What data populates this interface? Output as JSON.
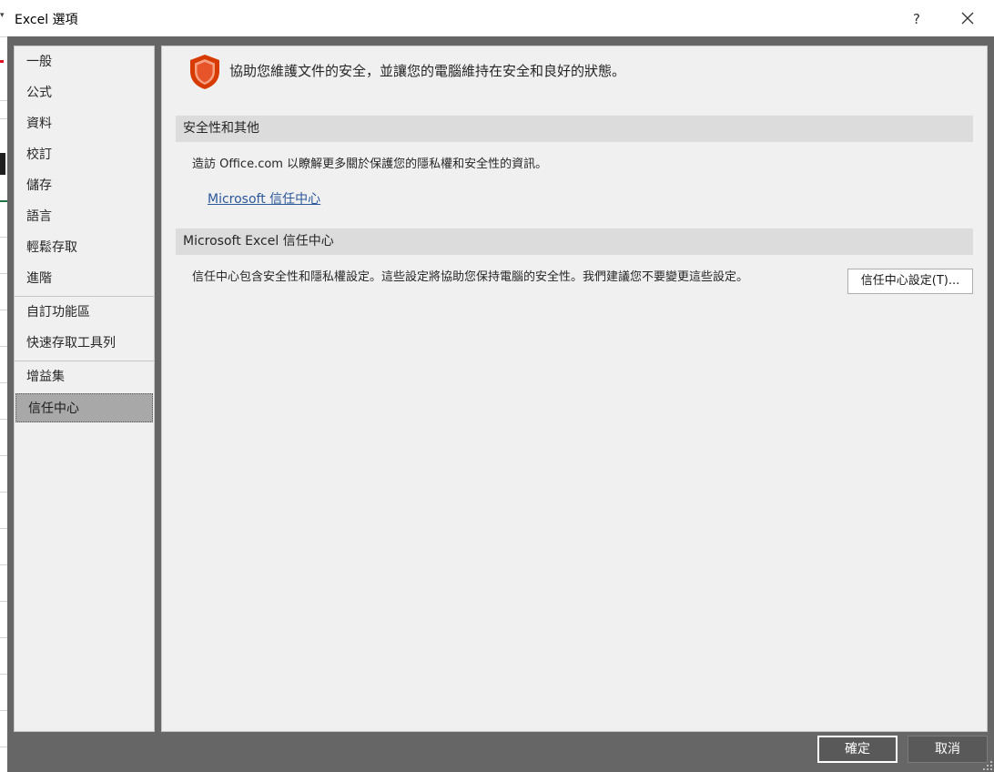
{
  "window": {
    "title": "Excel 選項",
    "help_label": "?"
  },
  "nav": {
    "items": [
      {
        "label": "一般"
      },
      {
        "label": "公式"
      },
      {
        "label": "資料"
      },
      {
        "label": "校訂"
      },
      {
        "label": "儲存"
      },
      {
        "label": "語言"
      },
      {
        "label": "輕鬆存取"
      },
      {
        "label": "進階"
      },
      {
        "label": "自訂功能區"
      },
      {
        "label": "快速存取工具列"
      },
      {
        "label": "增益集"
      },
      {
        "label": "信任中心",
        "selected": true
      }
    ]
  },
  "main": {
    "header_text": "協助您維護文件的安全，並讓您的電腦維持在安全和良好的狀態。",
    "section1": {
      "title": "安全性和其他",
      "description": "造訪 Office.com 以瞭解更多關於保護您的隱私權和安全性的資訊。",
      "link_text": "Microsoft 信任中心"
    },
    "section2": {
      "title": "Microsoft Excel 信任中心",
      "description": "信任中心包含安全性和隱私權設定。這些設定將協助您保持電腦的安全性。我們建議您不要變更這些設定。",
      "button_label": "信任中心設定(T)..."
    }
  },
  "footer": {
    "ok_label": "確定",
    "cancel_label": "取消"
  },
  "colors": {
    "shield": "#d83b01",
    "dialog_frame": "#666666",
    "panel": "#f0f0f0",
    "selected_nav": "#a8a8a8",
    "link": "#2b579a"
  },
  "icons": [
    "shield-icon",
    "close-icon",
    "resize-grip-icon"
  ]
}
